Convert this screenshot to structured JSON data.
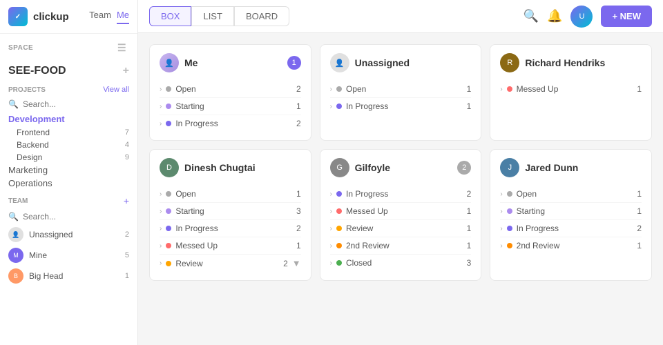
{
  "sidebar": {
    "logo": "clickup",
    "nav": [
      {
        "label": "Team",
        "active": false
      },
      {
        "label": "Me",
        "active": true
      }
    ],
    "space_label": "SPACE",
    "space_name": "SEE-FOOD",
    "projects_label": "PROJECTS",
    "view_all": "View all",
    "search_placeholder": "Search...",
    "projects": [
      {
        "name": "Development",
        "active": true
      },
      {
        "name": "Frontend",
        "count": "7"
      },
      {
        "name": "Backend",
        "count": "4"
      },
      {
        "name": "Design",
        "count": "9"
      }
    ],
    "other_items": [
      "Marketing",
      "Operations"
    ],
    "team_label": "TEAM",
    "team_members": [
      {
        "name": "Unassigned",
        "count": "2",
        "avatar_type": "unassigned"
      },
      {
        "name": "Mine",
        "count": "5",
        "avatar_type": "mine"
      },
      {
        "name": "Big Head",
        "count": "1",
        "avatar_type": "bighead"
      }
    ]
  },
  "topbar": {
    "views": [
      {
        "label": "BOX",
        "active": true
      },
      {
        "label": "LIST",
        "active": false
      },
      {
        "label": "BOARD",
        "active": false
      }
    ],
    "new_button": "+ NEW"
  },
  "cards": [
    {
      "id": "me",
      "name": "Me",
      "avatar_type": "me",
      "badge": "1",
      "rows": [
        {
          "status": "Open",
          "count": "2",
          "dot": "open"
        },
        {
          "status": "Starting",
          "count": "1",
          "dot": "starting"
        },
        {
          "status": "In Progress",
          "count": "2",
          "dot": "inprogress"
        }
      ]
    },
    {
      "id": "unassigned",
      "name": "Unassigned",
      "avatar_type": "unassigned",
      "badge": null,
      "rows": [
        {
          "status": "Open",
          "count": "1",
          "dot": "open"
        },
        {
          "status": "In Progress",
          "count": "1",
          "dot": "inprogress"
        }
      ]
    },
    {
      "id": "richard",
      "name": "Richard Hendriks",
      "avatar_type": "richard",
      "badge": null,
      "rows": [
        {
          "status": "Messed Up",
          "count": "1",
          "dot": "messedup"
        }
      ]
    },
    {
      "id": "dinesh",
      "name": "Dinesh Chugtai",
      "avatar_type": "dinesh",
      "badge": null,
      "rows": [
        {
          "status": "Open",
          "count": "1",
          "dot": "open"
        },
        {
          "status": "Starting",
          "count": "3",
          "dot": "starting"
        },
        {
          "status": "In Progress",
          "count": "2",
          "dot": "inprogress"
        },
        {
          "status": "Messed Up",
          "count": "1",
          "dot": "messedup"
        },
        {
          "status": "Review",
          "count": "2",
          "dot": "review",
          "show_more": true
        }
      ]
    },
    {
      "id": "gilfoyle",
      "name": "Gilfoyle",
      "avatar_type": "gilfoyle",
      "badge": "2",
      "badge_type": "gray",
      "rows": [
        {
          "status": "In Progress",
          "count": "2",
          "dot": "inprogress"
        },
        {
          "status": "Messed Up",
          "count": "1",
          "dot": "messedup"
        },
        {
          "status": "Review",
          "count": "1",
          "dot": "review"
        },
        {
          "status": "2nd Review",
          "count": "1",
          "dot": "2ndreview"
        },
        {
          "status": "Closed",
          "count": "3",
          "dot": "closed"
        }
      ]
    },
    {
      "id": "jared",
      "name": "Jared Dunn",
      "avatar_type": "jared",
      "badge": null,
      "rows": [
        {
          "status": "Open",
          "count": "1",
          "dot": "open"
        },
        {
          "status": "Starting",
          "count": "1",
          "dot": "starting"
        },
        {
          "status": "In Progress",
          "count": "2",
          "dot": "inprogress"
        },
        {
          "status": "2nd Review",
          "count": "1",
          "dot": "2ndreview"
        }
      ]
    }
  ]
}
